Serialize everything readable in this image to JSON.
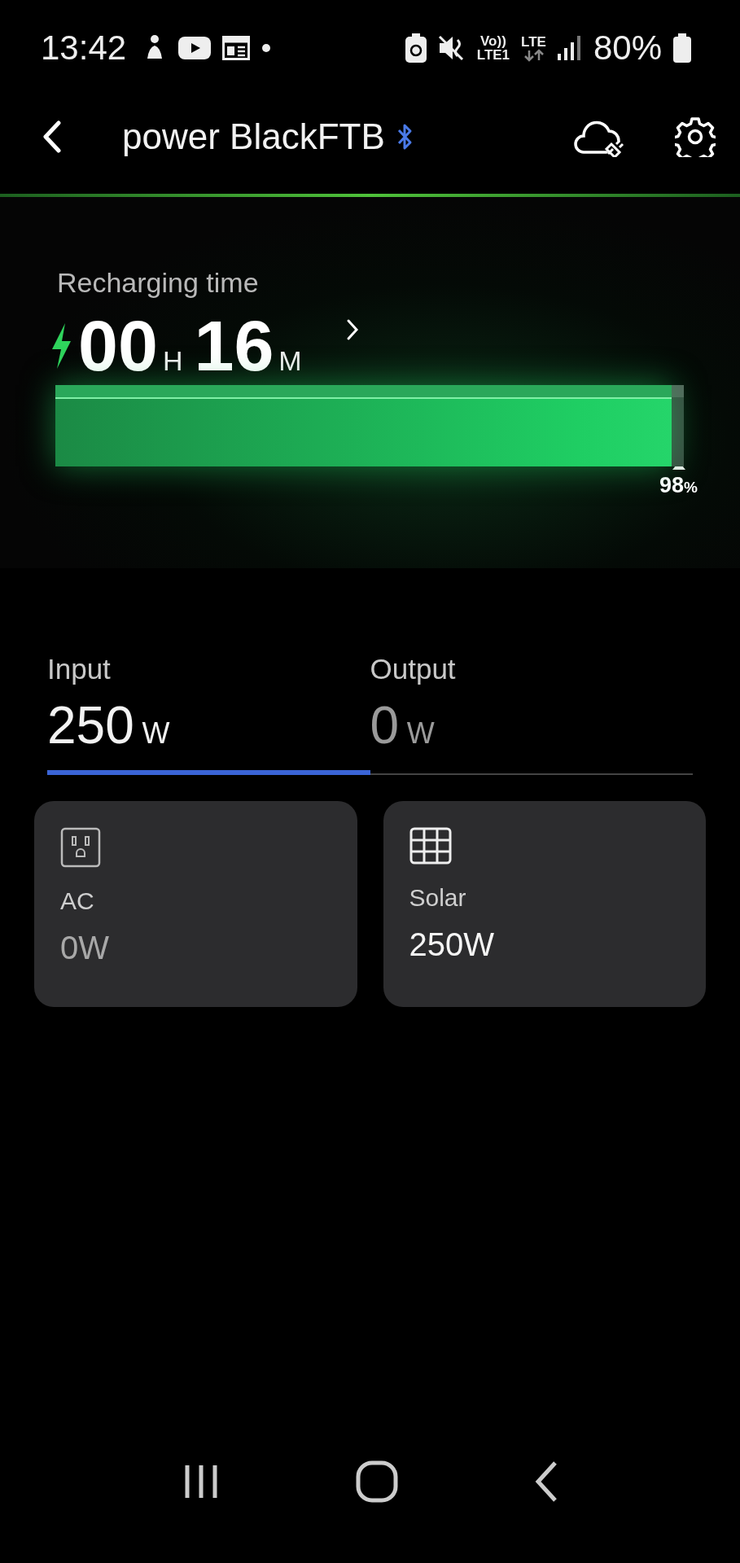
{
  "status_bar": {
    "time": "13:42",
    "volte": "Vo))",
    "volte_sub": "LTE1",
    "network": "LTE",
    "battery": "80%"
  },
  "header": {
    "title": "power BlackFTB",
    "bluetooth": true
  },
  "charging": {
    "label": "Recharging time",
    "hours": "00",
    "hours_unit": "H",
    "minutes": "16",
    "minutes_unit": "M",
    "level": 0.98,
    "percent": "98",
    "percent_unit": "%"
  },
  "tabs": [
    {
      "label": "Input",
      "value": "250",
      "unit": "W",
      "selected": true
    },
    {
      "label": "Output",
      "value": "0",
      "unit": "W",
      "selected": false
    }
  ],
  "sources": [
    {
      "kind": "ac",
      "name": "AC",
      "value": "0W",
      "active": false
    },
    {
      "kind": "solar",
      "name": "Solar",
      "value": "250W",
      "active": true
    }
  ]
}
